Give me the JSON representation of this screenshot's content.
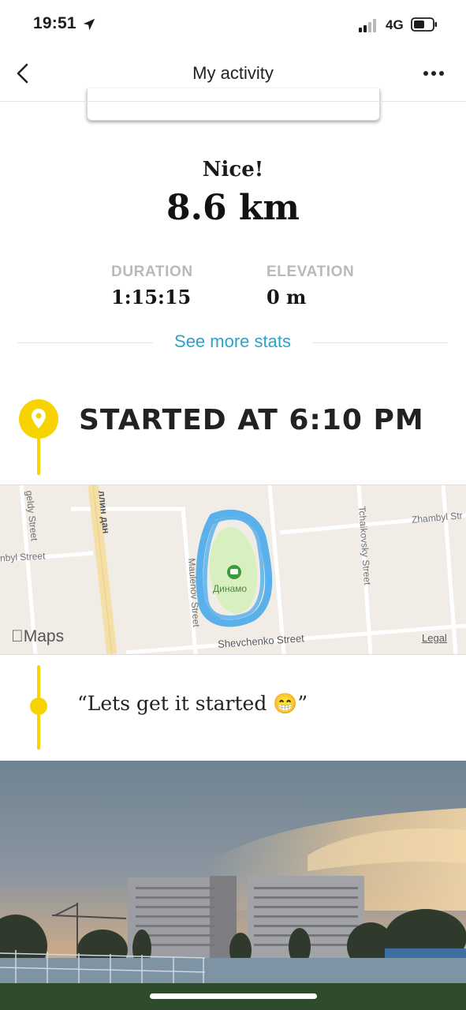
{
  "status_bar": {
    "time": "19:51",
    "network": "4G",
    "icons": [
      "location-arrow-icon",
      "signal-bars-icon",
      "battery-icon"
    ]
  },
  "header": {
    "title": "My activity",
    "back_icon": "chevron-left-icon",
    "more_icon": "ellipsis-icon"
  },
  "summary": {
    "headline": "Nice!",
    "distance": "8.6 km",
    "stats": [
      {
        "label": "DURATION",
        "value": "1:15:15"
      },
      {
        "label": "ELEVATION",
        "value": "0 m"
      }
    ],
    "see_more": "See more stats"
  },
  "timeline": {
    "start_label": "STARTED AT 6:10 PM",
    "note": "“Lets get it started 😁”"
  },
  "map": {
    "attribution": "Maps",
    "legal": "Legal",
    "place": "Динамо",
    "streets": [
      "geldy Street",
      "ллин дан",
      "nbyl Street",
      "Maulenov Street",
      "Shevchenko Street",
      "Tchaikovsky Street",
      "Zhambyl Str"
    ],
    "colors": {
      "route": "#5ab0ea",
      "park": "#d8efc0",
      "road_highlight": "#f5dfa6"
    }
  },
  "colors": {
    "accent_yellow": "#f7d300",
    "link_blue": "#2aa3cf"
  }
}
